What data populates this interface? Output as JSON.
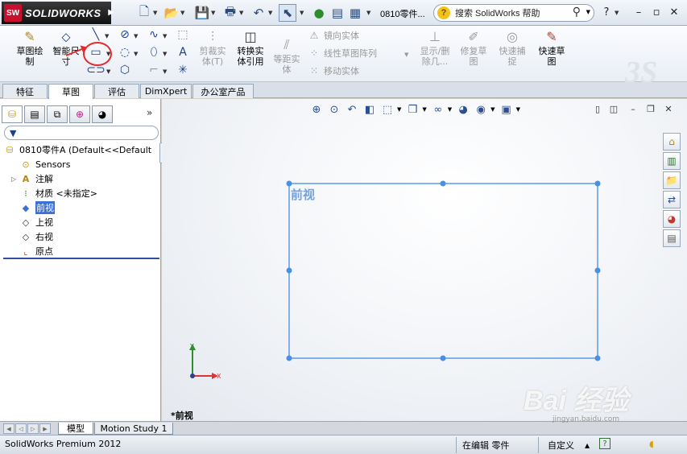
{
  "app": {
    "brand": "SOLIDWORKS",
    "document_title": "0810零件...",
    "help_search_placeholder": "搜索 SolidWorks 帮助"
  },
  "command_manager": {
    "buttons": [
      {
        "id": "sketch",
        "label": "草图绘\n制",
        "enabled": true
      },
      {
        "id": "smart-dim",
        "label": "智能尺\n寸",
        "enabled": true
      },
      {
        "id": "trim",
        "label": "剪裁实\n体(T)",
        "enabled": false
      },
      {
        "id": "convert",
        "label": "转换实\n体引用",
        "enabled": true
      },
      {
        "id": "offset",
        "label": "等距实\n体",
        "enabled": false
      },
      {
        "id": "show-hide",
        "label": "显示/删\n除几...",
        "enabled": false
      },
      {
        "id": "repair",
        "label": "修复草\n图",
        "enabled": false
      },
      {
        "id": "snap",
        "label": "快速捕\n捉",
        "enabled": false
      },
      {
        "id": "rapid-sketch",
        "label": "快速草\n图",
        "enabled": true
      }
    ],
    "row_buttons": [
      {
        "label": "镜向实体"
      },
      {
        "label": "线性草图阵列"
      },
      {
        "label": "移动实体"
      }
    ]
  },
  "tabs": [
    {
      "label": "特征",
      "active": false
    },
    {
      "label": "草图",
      "active": true
    },
    {
      "label": "评估",
      "active": false
    },
    {
      "label": "DimXpert",
      "active": false
    },
    {
      "label": "办公室产品",
      "active": false
    }
  ],
  "feature_tree": {
    "root": "0810零件A  (Default<<Default",
    "items": [
      {
        "label": "Sensors",
        "icon": "sensor-icon"
      },
      {
        "label": "注解",
        "icon": "annotation-icon",
        "expandable": true
      },
      {
        "label": "材质 <未指定>",
        "icon": "material-icon"
      },
      {
        "label": "前视",
        "icon": "plane-icon",
        "selected": true
      },
      {
        "label": "上视",
        "icon": "plane-icon"
      },
      {
        "label": "右视",
        "icon": "plane-icon"
      },
      {
        "label": "原点",
        "icon": "origin-icon"
      }
    ]
  },
  "graphics": {
    "plane_label": "前视",
    "view_name": "*前视",
    "triad": {
      "x": "X",
      "y": "Y"
    }
  },
  "bottom_tabs": [
    {
      "label": "模型",
      "active": true
    },
    {
      "label": "Motion Study 1",
      "active": false
    }
  ],
  "status_bar": {
    "product": "SolidWorks Premium 2012",
    "state": "在编辑 零件",
    "units": "自定义"
  },
  "watermark": {
    "text": "Bai 经验",
    "url": "jingyan.baidu.com"
  },
  "colors": {
    "selection": "#3b6fd8",
    "sketch_line": "#5b9be8",
    "annotation": "#e32b2b"
  }
}
